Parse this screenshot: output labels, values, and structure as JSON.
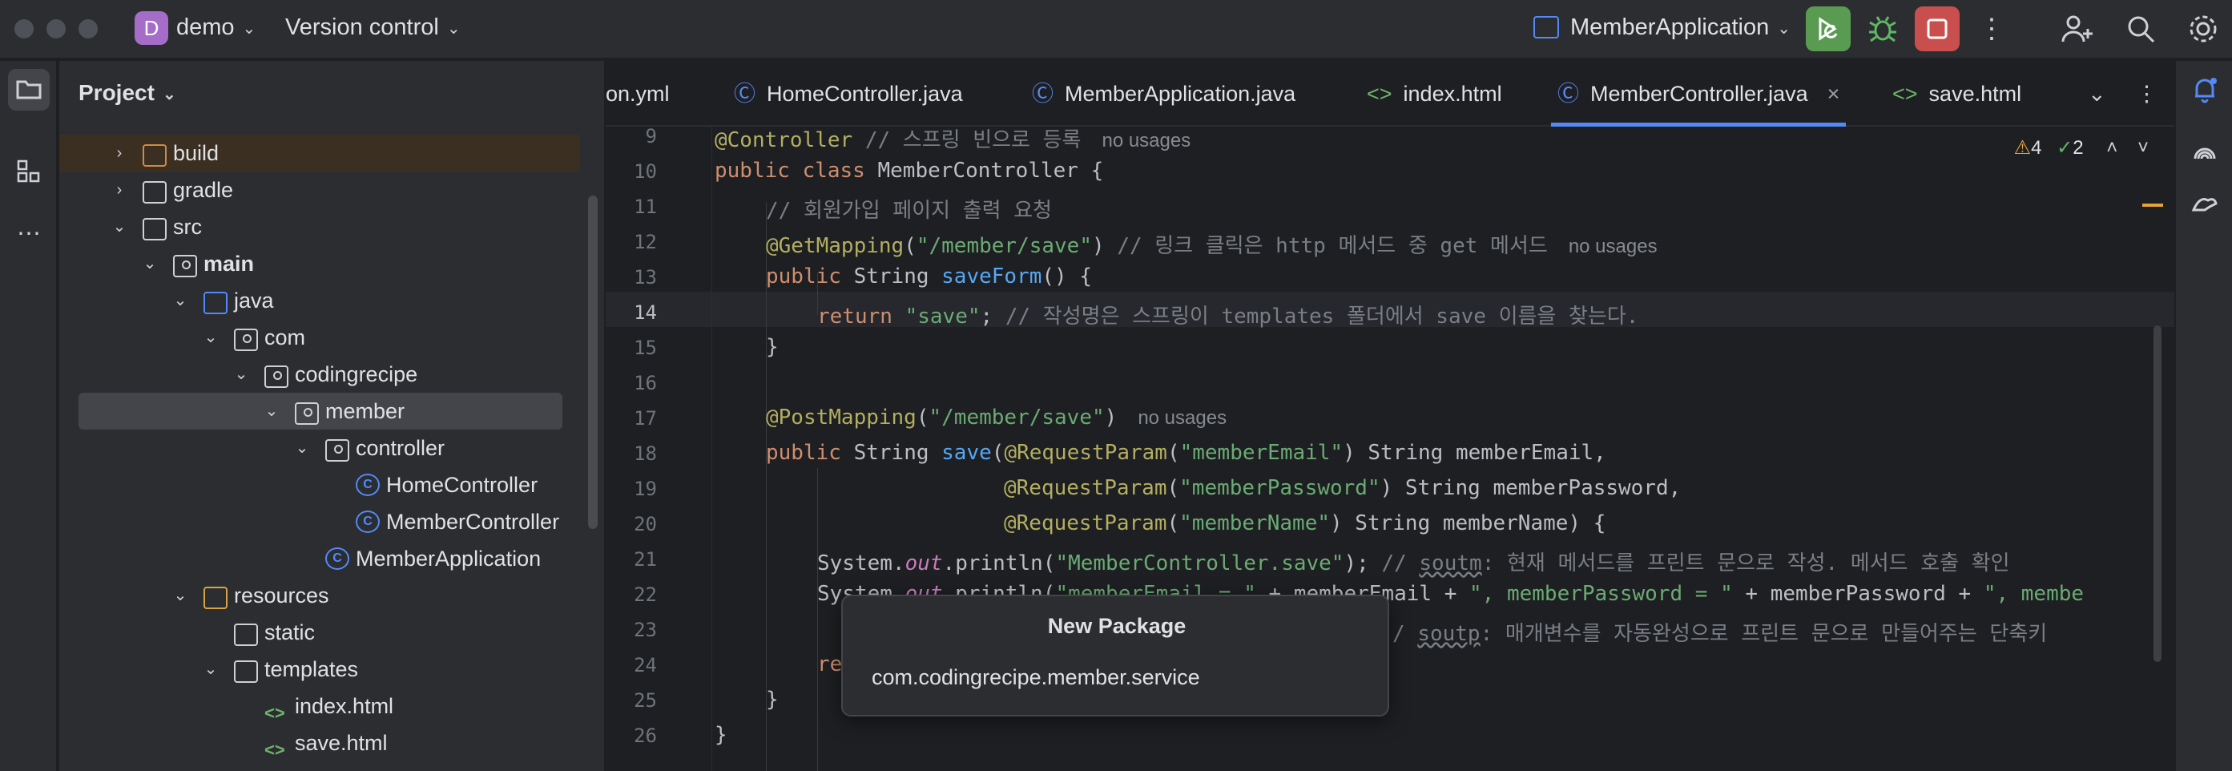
{
  "titlebar": {
    "project_initial": "D",
    "project_name": "demo",
    "vcs_label": "Version control",
    "run_config": "MemberApplication"
  },
  "colors": {
    "run_button": "#5a9b52",
    "stop_button": "#c94f4f",
    "debug_icon": "#5fb865",
    "accent": "#548af7"
  },
  "project_panel": {
    "header": "Project",
    "tree": [
      {
        "label": "build",
        "icon": "folder-icon",
        "expanded": false
      },
      {
        "label": "gradle",
        "icon": "folder-icon",
        "expanded": false
      },
      {
        "label": "src",
        "icon": "folder-icon",
        "expanded": true
      },
      {
        "label": "main",
        "icon": "source-folder-icon",
        "expanded": true
      },
      {
        "label": "java",
        "icon": "folder-blue-icon",
        "expanded": true
      },
      {
        "label": "com",
        "icon": "package-icon",
        "expanded": true
      },
      {
        "label": "codingrecipe",
        "icon": "package-icon",
        "expanded": true
      },
      {
        "label": "member",
        "icon": "package-icon",
        "expanded": true,
        "selected": true
      },
      {
        "label": "controller",
        "icon": "package-icon",
        "expanded": true
      },
      {
        "label": "HomeController",
        "icon": "class-icon"
      },
      {
        "label": "MemberController",
        "icon": "class-icon"
      },
      {
        "label": "MemberApplication",
        "icon": "spring-class-icon"
      },
      {
        "label": "resources",
        "icon": "resources-folder-icon",
        "expanded": true
      },
      {
        "label": "static",
        "icon": "folder-icon"
      },
      {
        "label": "templates",
        "icon": "folder-icon",
        "expanded": true
      },
      {
        "label": "index.html",
        "icon": "html-icon"
      },
      {
        "label": "save.html",
        "icon": "html-icon"
      }
    ]
  },
  "tabs": [
    {
      "label": "on.yml",
      "icon": "yaml-icon"
    },
    {
      "label": "HomeController.java",
      "icon": "class-icon"
    },
    {
      "label": "MemberApplication.java",
      "icon": "spring-class-icon"
    },
    {
      "label": "index.html",
      "icon": "html-icon"
    },
    {
      "label": "MemberController.java",
      "icon": "class-icon",
      "active": true
    },
    {
      "label": "save.html",
      "icon": "html-icon"
    }
  ],
  "inspections": {
    "warnings": "4",
    "ok": "2"
  },
  "code": {
    "line_numbers": [
      "9",
      "10",
      "11",
      "12",
      "13",
      "14",
      "15",
      "16",
      "17",
      "18",
      "19",
      "20",
      "21",
      "22",
      "23",
      "24",
      "25",
      "26"
    ],
    "current_line": "14",
    "hint_no_usages": "no usages",
    "l9_ann": "@Controller",
    "l9_cmt": " // 스프링 빈으로 등록",
    "l10_kw": "public class",
    "l10_name": " MemberController {",
    "l11_cmt": "// 회원가입 페이지 출력 요청",
    "l12_ann": "@GetMapping",
    "l12_p1": "(",
    "l12_str": "\"/member/save\"",
    "l12_p2": ") ",
    "l12_cmt": "// 링크 클릭은 http 메서드 중 get 메서드",
    "l13_kw": "public",
    "l13_type": " String ",
    "l13_name": "saveForm",
    "l13_rest": "() {",
    "l14_kw": "return",
    "l14_str": " \"save\"",
    "l14_p": "; ",
    "l14_cmt": "// 작성명은 스프링이 templates 폴더에서 save 이름을 찾는다.",
    "l15": "}",
    "l17_ann": "@PostMapping",
    "l17_p1": "(",
    "l17_str": "\"/member/save\"",
    "l17_p2": ")",
    "l18_kw": "public",
    "l18_type": " String ",
    "l18_name": "save",
    "l18_p1": "(",
    "l18_ann": "@RequestParam",
    "l18_p2": "(",
    "l18_str": "\"memberEmail\"",
    "l18_rest": ") String memberEmail,",
    "l19_ann": "@RequestParam",
    "l19_p1": "(",
    "l19_str": "\"memberPassword\"",
    "l19_rest": ") String memberPassword,",
    "l20_ann": "@RequestParam",
    "l20_p1": "(",
    "l20_str": "\"memberName\"",
    "l20_rest": ") String memberName) {",
    "l21_sys": "System.",
    "l21_out": "out",
    "l21_p1": ".println(",
    "l21_str": "\"MemberController.save\"",
    "l21_p2": "); ",
    "l21_cmt1": "// ",
    "l21_cmt_u": "soutm",
    "l21_cmt2": ": 현재 메서드를 프린트 문으로 작성. 메서드 호출 확인",
    "l22_sys": "System.",
    "l22_out": "out",
    "l22_p1": ".println(",
    "l22_str1": "\"memberEmail = \"",
    "l22_mid1": " + memberEmail + ",
    "l22_str2": "\", memberPassword = \"",
    "l22_mid2": " + memberPassword + ",
    "l22_str3": "\", memberName = ",
    "l23_cmt1": "/ ",
    "l23_cmt_u": "soutp",
    "l23_cmt2": ": 매개변수를 자동완성으로 프린트 문으로 만들어주는 단축키",
    "l24_kw": "re",
    "l25": "}",
    "l26": "}"
  },
  "popup": {
    "title": "New Package",
    "value": "com.codingrecipe.member.service"
  }
}
